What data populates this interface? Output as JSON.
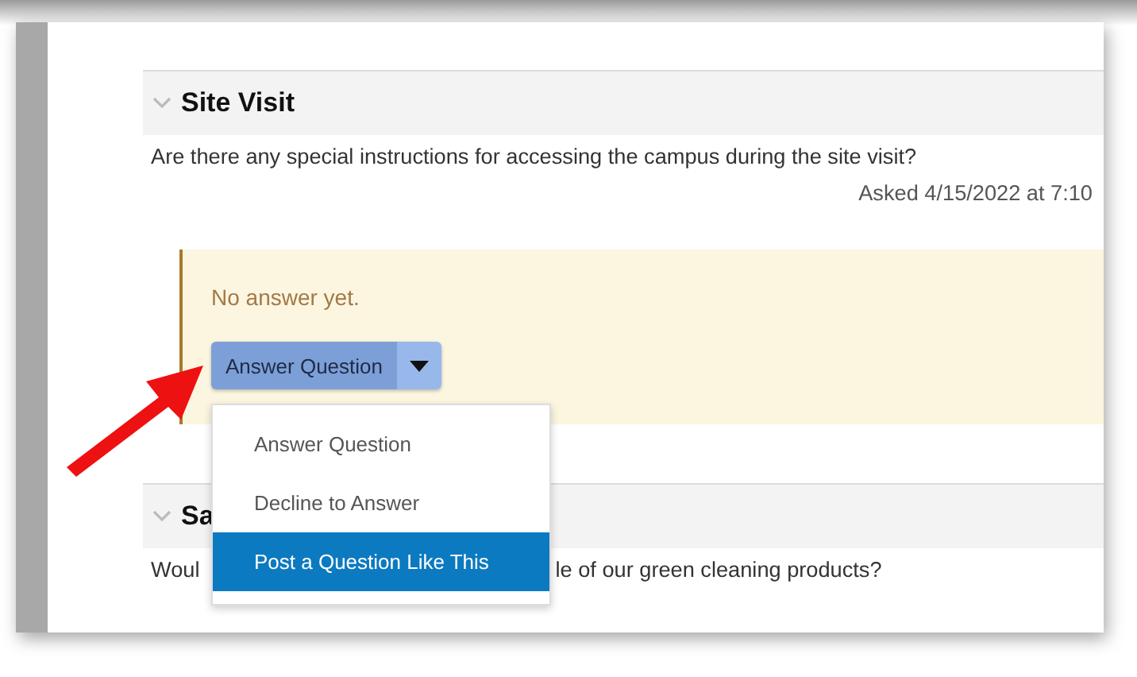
{
  "sections": [
    {
      "title": "Site Visit",
      "question_parts": [
        "Are there any special instructions for accessing the campus during the site visit?"
      ],
      "asked": "Asked 4/15/2022 at 7:10",
      "answer": {
        "status": "No answer yet.",
        "button": "Answer Question",
        "menu": [
          {
            "label": "Answer Question",
            "selected": false
          },
          {
            "label": "Decline to Answer",
            "selected": false
          },
          {
            "label": "Post a Question Like This",
            "selected": true
          }
        ]
      }
    },
    {
      "title": "Sa",
      "question_parts": [
        "Woul",
        "le of our green cleaning products?"
      ]
    }
  ]
}
